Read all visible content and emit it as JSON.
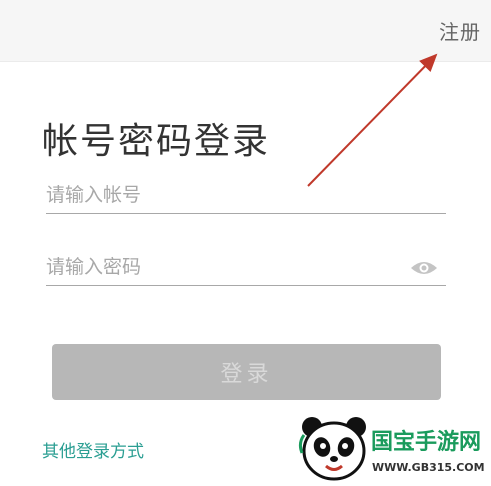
{
  "header": {
    "register_label": "注册"
  },
  "login": {
    "title": "帐号密码登录",
    "account_placeholder": "请输入帐号",
    "password_placeholder": "请输入密码",
    "submit_label": "登录",
    "other_methods_label": "其他登录方式"
  },
  "annotation": {
    "arrow_color": "#c0392b"
  },
  "watermark": {
    "brand": "国宝手游网",
    "url": "WWW.GB315.COM",
    "brand_color": "#1a9b5c"
  },
  "colors": {
    "accent_link": "#2a9e92",
    "button_disabled": "#b7b7b7",
    "topbar_bg": "#f6f6f6"
  }
}
